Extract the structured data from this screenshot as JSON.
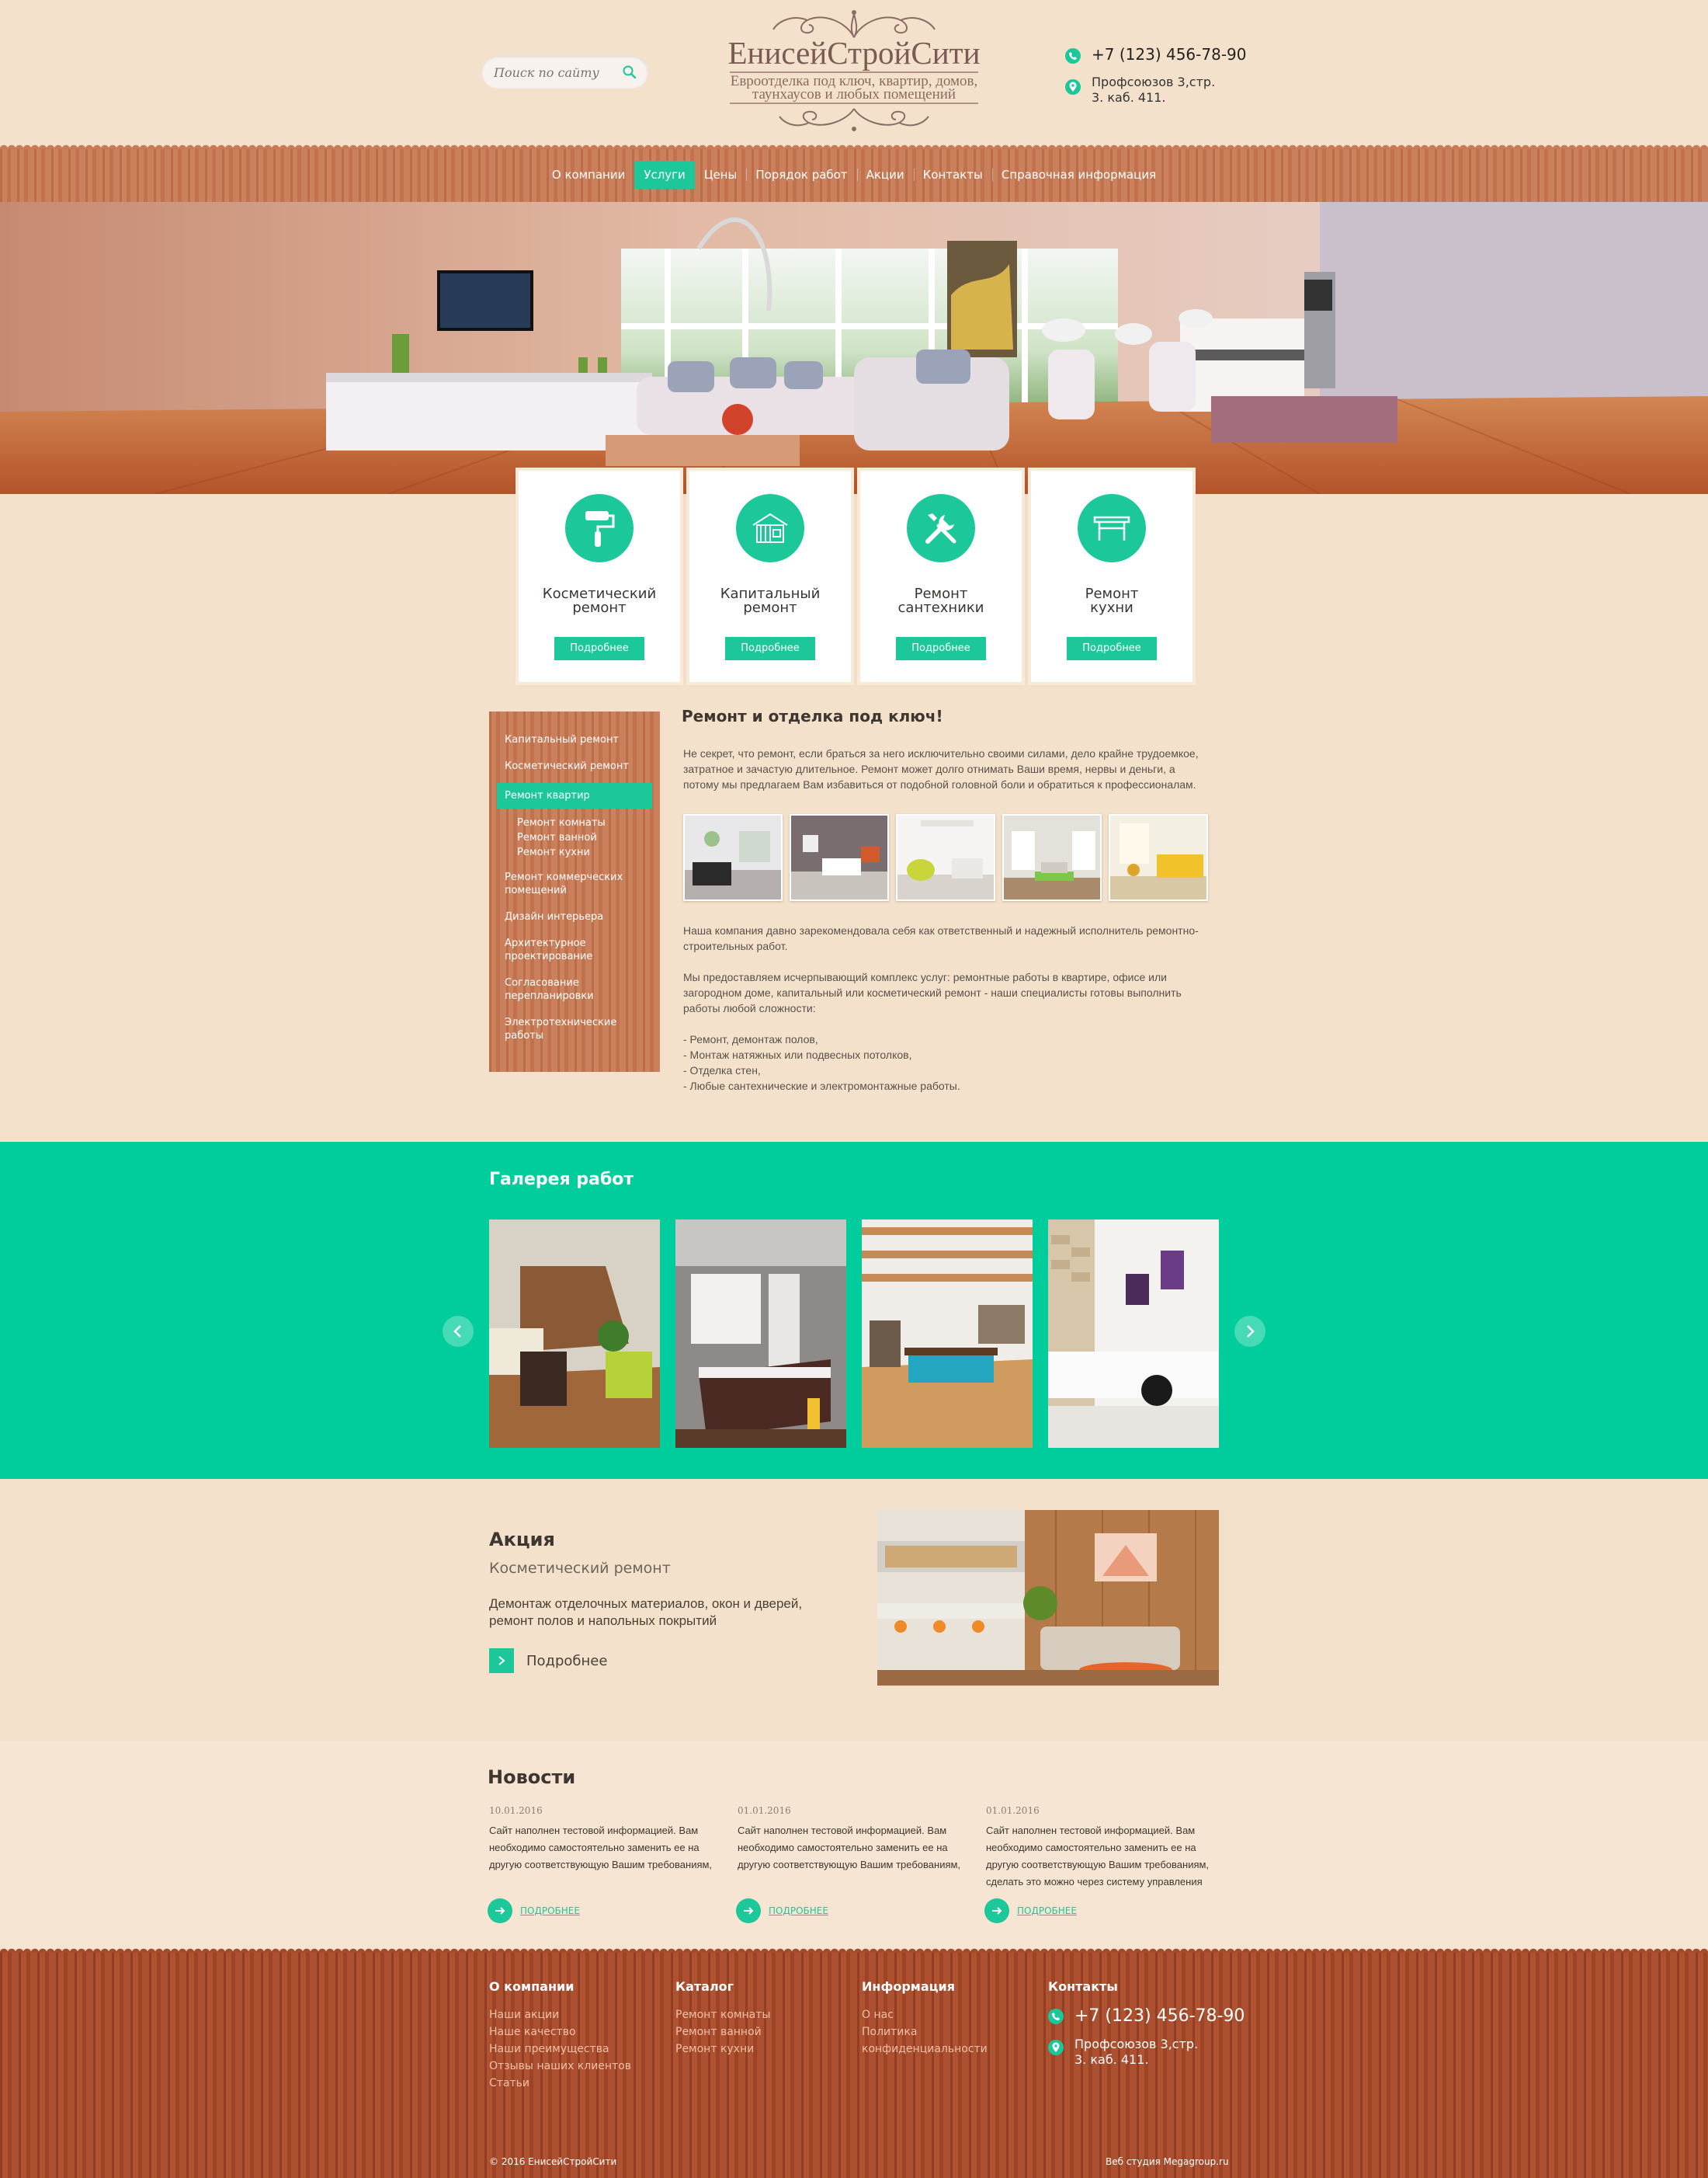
{
  "header": {
    "search_placeholder": "Поиск по сайту",
    "logo_name": "ЕнисейСтройСити",
    "logo_tagline_1": "Евроотделка под ключ, квартир, домов,",
    "logo_tagline_2": "таунхаусов и любых помещений",
    "phone": "+7 (123) 456-78-90",
    "address": "Профсоюзов 3,стр. 3. каб. 411."
  },
  "nav": {
    "items": [
      {
        "label": "О компании"
      },
      {
        "label": "Услуги",
        "active": true
      },
      {
        "label": "Цены"
      },
      {
        "label": "Порядок работ"
      },
      {
        "label": "Акции"
      },
      {
        "label": "Контакты"
      },
      {
        "label": "Справочная информация"
      }
    ]
  },
  "services": {
    "button_label": "Подробнее",
    "items": [
      {
        "title_1": "Косметический",
        "title_2": "ремонт",
        "icon": "paint-roller-icon"
      },
      {
        "title_1": "Капитальный",
        "title_2": "ремонт",
        "icon": "house-icon"
      },
      {
        "title_1": "Ремонт",
        "title_2": "сантехники",
        "icon": "tools-icon"
      },
      {
        "title_1": "Ремонт",
        "title_2": "кухни",
        "icon": "table-icon"
      }
    ]
  },
  "sidebar": {
    "items": [
      {
        "label": "Капитальный ремонт"
      },
      {
        "label": "Косметический ремонт"
      },
      {
        "label": "Ремонт квартир",
        "active": true
      },
      {
        "label": "Ремонт комнаты",
        "sub": true
      },
      {
        "label": "Ремонт ванной",
        "sub": true
      },
      {
        "label": "Ремонт кухни",
        "sub": true
      },
      {
        "label": "Ремонт коммерческих помещений"
      },
      {
        "label": "Дизайн интерьера"
      },
      {
        "label": "Архитектурное проектирование"
      },
      {
        "label": "Согласование перепланировки"
      },
      {
        "label": "Электротехнические работы"
      }
    ]
  },
  "main": {
    "title": "Ремонт и отделка под ключ!",
    "intro": "Не секрет, что ремонт, если браться за него исключительно своими силами, дело крайне трудоемкое, затратное и зачастую длительное. Ремонт может долго отнимать Ваши время, нервы и деньги, а потому мы предлагаем Вам избавиться от подобной головной боли и обратиться к профессионалам.",
    "p1": "Наша компания давно зарекомендовала себя как ответственный и надежный исполнитель ремонтно-строительных работ.",
    "p2": "Мы предоставляем исчерпывающий комплекс услуг: ремонтные работы в квартире, офисе или загородном доме, капитальный или косметический ремонт - наши специалисты готовы выполнить работы любой сложности:",
    "list": [
      "- Ремонт, демонтаж полов,",
      "- Монтаж натяжных или подвесных потолков,",
      "- Отделка стен,",
      "- Любые сантехнические и электромонтажные работы."
    ]
  },
  "gallery": {
    "title": "Галерея работ"
  },
  "promo": {
    "title": "Акция",
    "subtitle": "Косметический ремонт",
    "description": "Демонтаж отделочных материалов, окон и дверей, ремонт полов и напольных покрытий",
    "more_label": "Подробнее"
  },
  "news": {
    "title": "Новости",
    "link_label": "ПОДРОБНЕЕ",
    "items": [
      {
        "date": "10.01.2016",
        "text": "Сайт наполнен тестовой информацией. Вам необходимо самостоятельно заменить ее на другую соответствующую Вашим требованиям,"
      },
      {
        "date": "01.01.2016",
        "text": "Сайт наполнен тестовой информацией. Вам необходимо самостоятельно заменить ее на другую соответствующую Вашим требованиям,"
      },
      {
        "date": "01.01.2016",
        "text": "Сайт наполнен тестовой информацией. Вам необходимо самостоятельно заменить ее на другую соответствующую Вашим требованиям, сделать это можно через систему управления"
      }
    ]
  },
  "footer": {
    "col1": {
      "title": "О компании",
      "links": [
        "Наши акции",
        "Наше качество",
        "Наши преимущества",
        "Отзывы наших клиентов",
        "Статьи"
      ]
    },
    "col2": {
      "title": "Каталог",
      "links": [
        "Ремонт комнаты",
        "Ремонт ванной",
        "Ремонт кухни"
      ]
    },
    "col3": {
      "title": "Информация",
      "links": [
        "О нас",
        "Политика",
        "конфиденциальности"
      ]
    },
    "col4": {
      "title": "Контакты",
      "phone": "+7 (123) 456-78-90",
      "address": "Профсоюзов 3,стр. 3. каб. 411."
    },
    "copyright": "© 2016 ЕнисейСтройСити",
    "studio": "Веб студия Megagroup.ru"
  },
  "colors": {
    "accent": "#1cc899",
    "wood": "#c77a55",
    "wood_dark": "#a84a2a",
    "background": "#f3e1cb"
  }
}
